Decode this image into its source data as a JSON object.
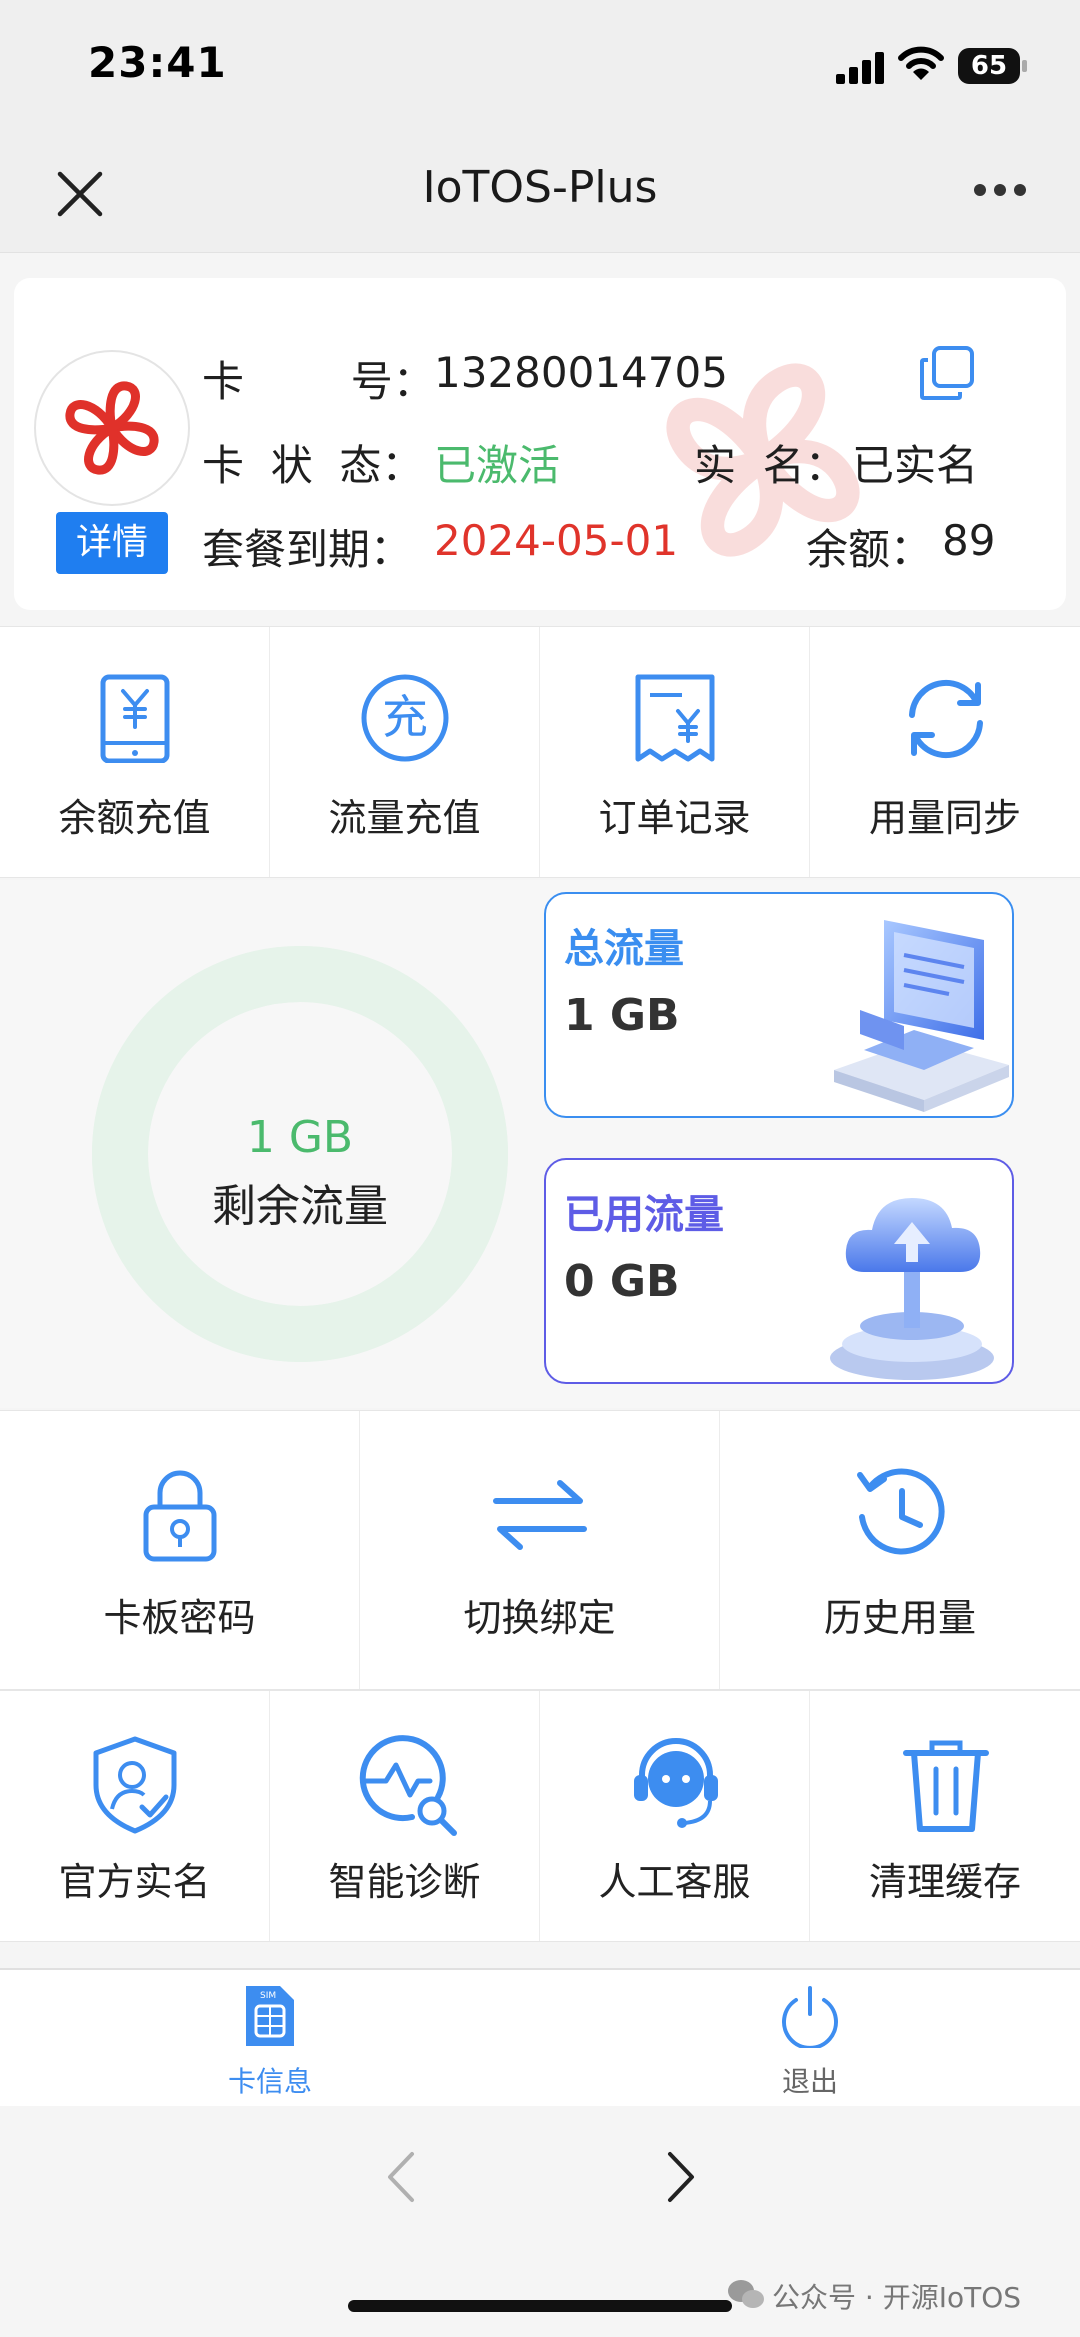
{
  "status_bar": {
    "time": "23:41",
    "battery": "65"
  },
  "nav": {
    "title": "IoTOS-Plus"
  },
  "card": {
    "number_label": "卡        号：",
    "number_value": "13280014705",
    "status_label": "卡  状  态：",
    "status_value": "已激活",
    "realname_label": "实  名：",
    "realname_value": "已实名",
    "expiry_label": "套餐到期：",
    "expiry_value": "2024-05-01",
    "balance_label": "余额：",
    "balance_value": "89",
    "detail_button": "详情"
  },
  "actions_row1": [
    {
      "label": "余额充值",
      "icon": "balance-recharge-icon"
    },
    {
      "label": "流量充值",
      "icon": "data-recharge-icon",
      "glyph": "充"
    },
    {
      "label": "订单记录",
      "icon": "order-record-icon"
    },
    {
      "label": "用量同步",
      "icon": "sync-icon"
    }
  ],
  "traffic": {
    "remaining_value": "1 GB",
    "remaining_label": "剩余流量",
    "total_title": "总流量",
    "total_value": "1 GB",
    "used_title": "已用流量",
    "used_value": "0 GB",
    "remaining_fraction": 1.0
  },
  "actions_row2": [
    {
      "label": "卡板密码",
      "icon": "lock-icon"
    },
    {
      "label": "切换绑定",
      "icon": "switch-icon"
    },
    {
      "label": "历史用量",
      "icon": "history-icon"
    }
  ],
  "actions_row3": [
    {
      "label": "官方实名",
      "icon": "verify-shield-icon"
    },
    {
      "label": "智能诊断",
      "icon": "diagnose-icon"
    },
    {
      "label": "人工客服",
      "icon": "customer-service-icon"
    },
    {
      "label": "清理缓存",
      "icon": "trash-icon"
    }
  ],
  "tabbar": {
    "card_info_label": "卡信息",
    "sim_text": "SIM",
    "logout_label": "退出"
  },
  "footer": {
    "watermark": "公众号 · 开源IoTOS"
  },
  "colors": {
    "accent": "#1f7ef0",
    "icon_blue": "#3d8df0",
    "active_green": "#4bba6d",
    "expiry_red": "#e0342b",
    "used_purple": "#5e5ce6",
    "total_blue": "#3a8ef0",
    "unicom_red": "#e0312a"
  }
}
